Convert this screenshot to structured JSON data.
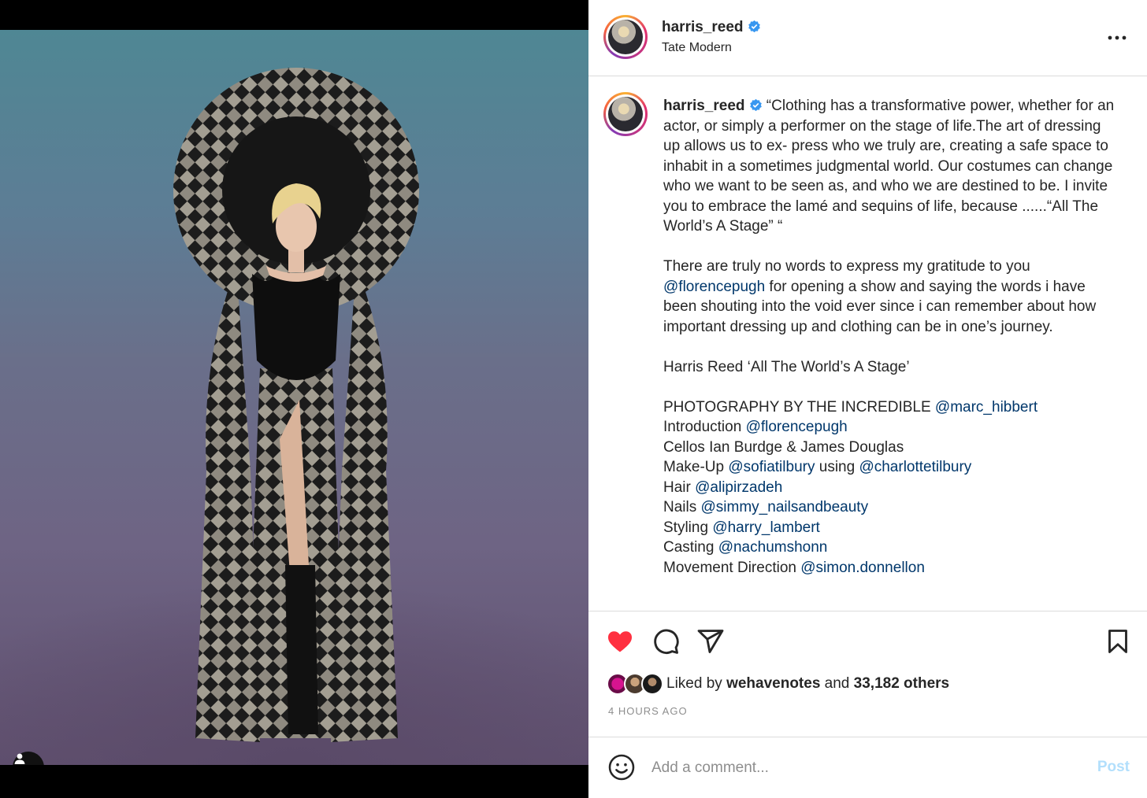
{
  "post": {
    "username": "harris_reed",
    "location": "Tate Modern",
    "verified": true
  },
  "caption": {
    "username": "harris_reed",
    "p1": "“Clothing has a transformative power, whether for an actor, or simply a performer on the stage of life.The art of dressing up allows us to ex- press who we truly are, creating a safe space to inhabit in a sometimes judgmental world. Our costumes can change who we want to be seen as, and who we are destined to be. I invite you to embrace the lamé and sequins of life, because ......“All The World’s A Stage” “",
    "p2_before": "There are truly no words to express my gratitude to you ",
    "p2_mention": "@florencepugh",
    "p2_after": " for opening a show and saying the words i have been shouting into the void ever since i can remember about how important dressing up and clothing can be in one’s journey.",
    "p3": "Harris Reed ‘All The World’s A Stage’",
    "credits": [
      {
        "label": "PHOTOGRAPHY BY THE INCREDIBLE ",
        "mention": "@marc_hibbert",
        "mid": "",
        "mention2": ""
      },
      {
        "label": "Introduction ",
        "mention": "@florencepugh",
        "mid": "",
        "mention2": ""
      },
      {
        "label": "Cellos Ian Burdge & James Douglas",
        "mention": "",
        "mid": "",
        "mention2": ""
      },
      {
        "label": "Make-Up ",
        "mention": "@sofiatilbury",
        "mid": " using ",
        "mention2": "@charlottetilbury"
      },
      {
        "label": "Hair ",
        "mention": "@alipirzadeh",
        "mid": "",
        "mention2": ""
      },
      {
        "label": "Nails ",
        "mention": "@simmy_nailsandbeauty",
        "mid": "",
        "mention2": ""
      },
      {
        "label": "Styling ",
        "mention": "@harry_lambert",
        "mid": "",
        "mention2": ""
      },
      {
        "label": "Casting ",
        "mention": "@nachumshonn",
        "mid": "",
        "mention2": ""
      },
      {
        "label": "Movement Direction ",
        "mention": "@simon.donnellon",
        "mid": "",
        "mention2": ""
      }
    ]
  },
  "engagement": {
    "liked_by_prefix": "Liked by ",
    "liked_by_user": "wehavenotes",
    "liked_by_mid": " and ",
    "others": "33,182 others",
    "timestamp": "4 HOURS AGO",
    "liked": true
  },
  "comment": {
    "placeholder": "Add a comment...",
    "post_label": "Post"
  },
  "icons": {
    "like": "heart-icon",
    "comment": "comment-icon",
    "share": "share-icon",
    "save": "bookmark-icon",
    "emoji": "emoji-icon",
    "tags": "user-tag-icon",
    "more": "more-icon"
  },
  "colors": {
    "heart": "#ff3040",
    "link": "#00376b",
    "post_disabled": "#b2dffc",
    "verified": "#3897f0"
  }
}
